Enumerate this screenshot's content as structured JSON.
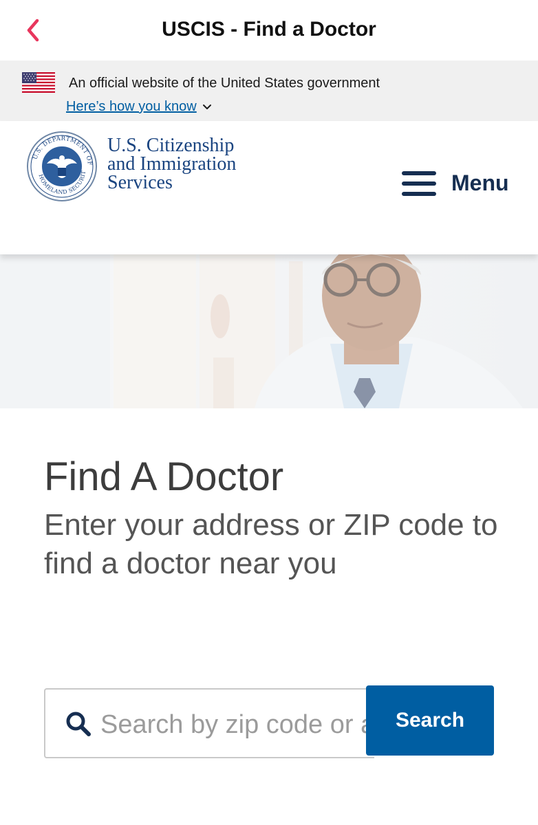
{
  "navbar": {
    "title": "USCIS - Find a Doctor",
    "back_icon": "chevron-left-icon",
    "accent_color": "#e8365d"
  },
  "gov_banner": {
    "official_text": "An official website of the United States government",
    "how_you_know": "Here’s how you know",
    "how_you_know_icon": "chevron-down-icon"
  },
  "header": {
    "agency_line1": "U.S. Citizenship",
    "agency_line2": "and Immigration",
    "agency_line3": "Services",
    "menu_label": "Menu",
    "menu_icon": "hamburger-icon",
    "brand_color": "#1a4480"
  },
  "main": {
    "title": "Find A Doctor",
    "subtitle": "Enter your address or ZIP code to find a doctor near you"
  },
  "search": {
    "placeholder": "Search by zip code or address",
    "button_label": "Search",
    "button_color": "#005ea2"
  }
}
